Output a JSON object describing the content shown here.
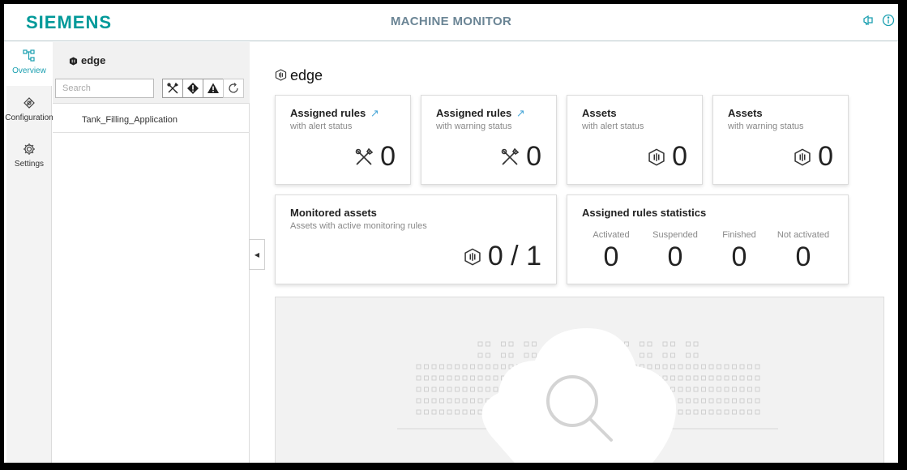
{
  "header": {
    "logo": "SIEMENS",
    "title": "MACHINE MONITOR",
    "icons": [
      "notification-icon",
      "info-icon"
    ]
  },
  "nav": {
    "items": [
      {
        "label": "Overview",
        "icon": "hierarchy-icon",
        "active": true
      },
      {
        "label": "Configuration",
        "icon": "configuration-icon",
        "active": false
      },
      {
        "label": "Settings",
        "icon": "gear-icon",
        "active": false
      }
    ]
  },
  "tree": {
    "root": "edge",
    "search_placeholder": "Search",
    "filters": [
      "tools-icon",
      "alert-icon",
      "warning-icon",
      "refresh-icon"
    ],
    "nodes": [
      "Tank_Filling_Application"
    ]
  },
  "main": {
    "title": "edge",
    "cards": {
      "rules_alert": {
        "title": "Assigned rules",
        "link": "↗",
        "subtitle": "with alert status",
        "value": "0"
      },
      "rules_warning": {
        "title": "Assigned rules",
        "link": "↗",
        "subtitle": "with warning status",
        "value": "0"
      },
      "assets_alert": {
        "title": "Assets",
        "subtitle": "with alert status",
        "value": "0"
      },
      "assets_warning": {
        "title": "Assets",
        "subtitle": "with warning status",
        "value": "0"
      },
      "monitored": {
        "title": "Monitored assets",
        "subtitle": "Assets with active monitoring rules",
        "value": "0 / 1"
      },
      "stats": {
        "title": "Assigned rules statistics",
        "items": [
          {
            "label": "Activated",
            "value": "0"
          },
          {
            "label": "Suspended",
            "value": "0"
          },
          {
            "label": "Finished",
            "value": "0"
          },
          {
            "label": "Not activated",
            "value": "0"
          }
        ]
      }
    }
  },
  "colors": {
    "brand": "#009999",
    "accent": "#1a9fb0",
    "link": "#4aa7d8"
  }
}
